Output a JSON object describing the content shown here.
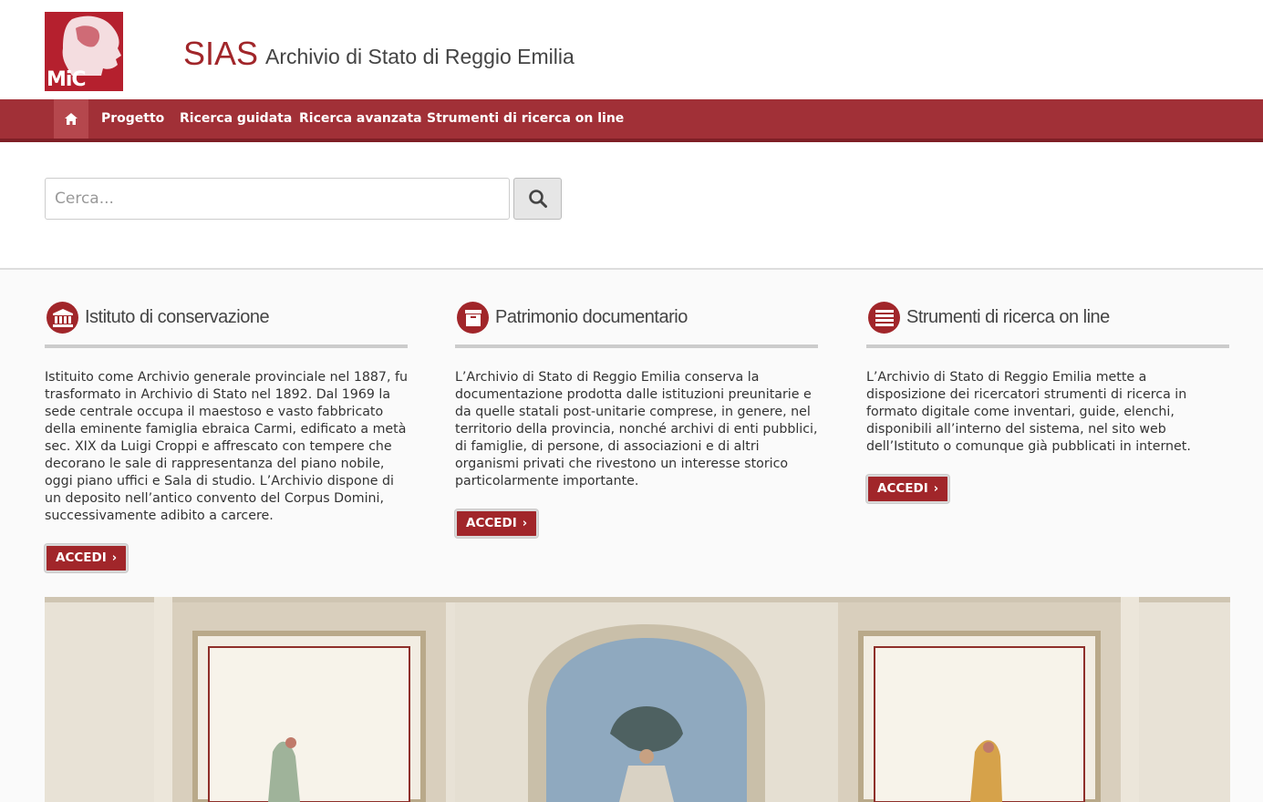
{
  "header": {
    "logo_text": "MiC",
    "site_acronym": "SIAS",
    "site_name": "Archivio di Stato di Reggio Emilia"
  },
  "nav": {
    "home_icon": "home-icon",
    "items": [
      {
        "label": "Progetto"
      },
      {
        "label": "Ricerca guidata"
      },
      {
        "label": "Ricerca avanzata"
      },
      {
        "label": "Strumenti di ricerca on line"
      }
    ]
  },
  "search": {
    "placeholder": "Cerca...",
    "button_icon": "search-icon"
  },
  "columns": [
    {
      "icon": "institution-icon",
      "title": "Istituto di conservazione",
      "text": "Istituito come Archivio generale provinciale nel 1887, fu trasformato in Archivio di Stato nel 1892. Dal 1969 la sede centrale occupa il maestoso e vasto fabbricato della eminente famiglia ebraica Carmi, edificato a metà sec. XIX da Luigi Croppi e affrescato con tempere che decorano le sale di rappresentanza del piano nobile, oggi piano uffici e Sala di studio. L’Archivio dispone di un deposito nell’antico convento del Corpus Domini, successivamente adibito a carcere.",
      "button": "ACCEDI"
    },
    {
      "icon": "archive-box-icon",
      "title": "Patrimonio documentario",
      "text": "L’Archivio di Stato di Reggio Emilia conserva la documentazione prodotta dalle istituzioni preunitarie e da quelle statali post-unitarie comprese, in genere, nel territorio della provincia, nonché archivi di enti pubblici, di famiglie, di persone, di associazioni e di altri organismi privati che rivestono un interesse storico particolarmente importante.",
      "button": "ACCEDI"
    },
    {
      "icon": "list-icon",
      "title": "Strumenti di ricerca on line",
      "text": "L’Archivio di Stato di Reggio Emilia mette a disposizione dei ricercatori strumenti di ricerca in formato digitale come inventari, guide, elenchi, disponibili all’interno del sistema, nel sito web dell’Istituto o comunque già pubblicati in internet.",
      "button": "ACCEDI"
    }
  ],
  "colors": {
    "brand": "#a1262a",
    "nav_bg": "#a13037"
  }
}
